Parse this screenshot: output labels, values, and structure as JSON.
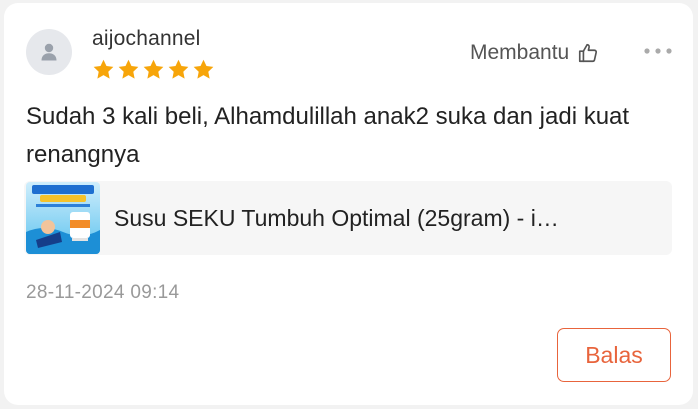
{
  "review": {
    "username": "aijochannel",
    "rating": 5,
    "rating_max": 5,
    "star_color": "#f7a50a",
    "helpful_label": "Membantu",
    "text": "Sudah 3 kali beli, Alhamdulillah anak2 suka dan jadi kuat renangnya",
    "product_name": "Susu SEKU Tumbuh Optimal (25gram) - i…",
    "timestamp": "28-11-2024 09:14",
    "reply_label": "Balas"
  },
  "icons": {
    "avatar": "user-icon",
    "helpful": "thumbs-up-icon",
    "more": "more-options-icon"
  },
  "colors": {
    "accent": "#e8643c",
    "star": "#f7a50a"
  }
}
